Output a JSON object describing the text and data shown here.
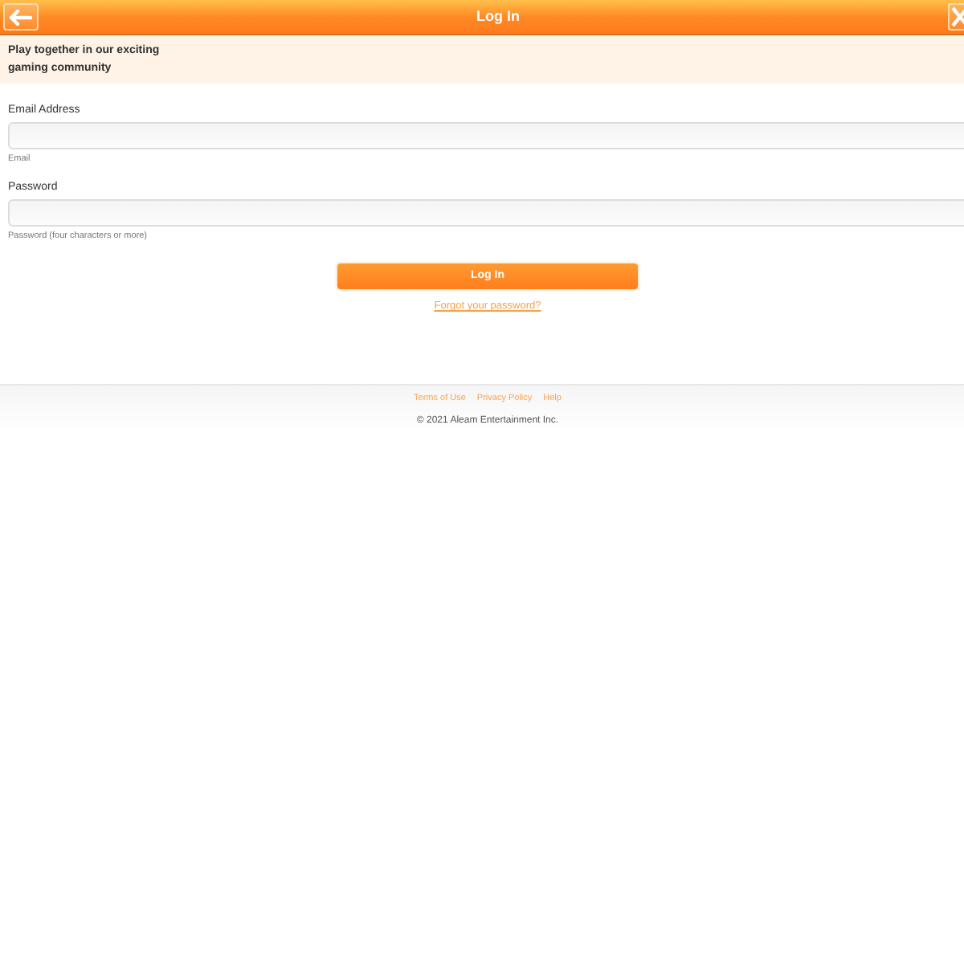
{
  "header": {
    "title": "Log In"
  },
  "tagline": "Play together in our exciting gaming community",
  "form": {
    "fields": [
      {
        "label": "Email Address",
        "hint": "Email"
      },
      {
        "label": "Password",
        "hint": "Password (four characters or more)"
      }
    ],
    "submit": "Log In",
    "forgot_link": "Forgot your password?"
  },
  "footer": {
    "links": [
      "Terms of Use",
      "Privacy Policy",
      "Help"
    ],
    "copyright": "© 2021 Aleam Entertainment Inc."
  }
}
